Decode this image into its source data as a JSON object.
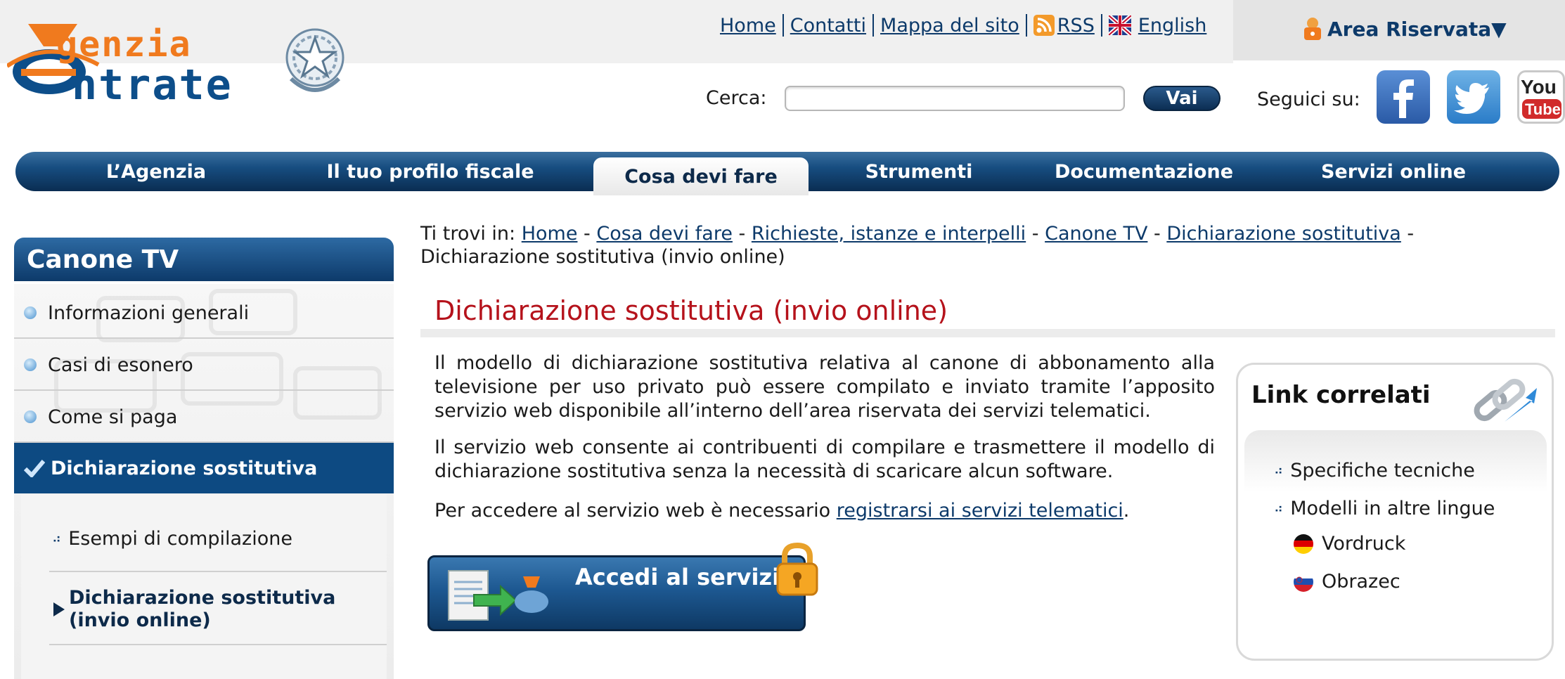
{
  "header": {
    "logo_line1": "genzia",
    "logo_line2": "ntrate",
    "top_links": [
      {
        "label": "Home"
      },
      {
        "label": "Contatti"
      },
      {
        "label": "Mappa del sito"
      },
      {
        "label": "RSS",
        "icon": "rss-icon"
      },
      {
        "label": "English",
        "icon": "uk-flag-icon"
      }
    ],
    "area_riservata": "Area Riservata▼",
    "search_label": "Cerca:",
    "search_value": "",
    "search_button": "Vai",
    "social_label": "Seguici su:",
    "social": [
      "facebook-icon",
      "twitter-icon",
      "youtube-icon"
    ],
    "youtube_text1": "You",
    "youtube_text2": "Tube"
  },
  "nav": {
    "items": [
      "L’Agenzia",
      "Il tuo profilo fiscale",
      "Cosa devi fare",
      "Strumenti",
      "Documentazione",
      "Servizi online"
    ],
    "active_index": 2
  },
  "sidebar": {
    "title": "Canone TV",
    "items": [
      "Informazioni generali",
      "Casi di esonero",
      "Come si paga",
      "Dichiarazione sostitutiva"
    ],
    "active_index": 3,
    "subitems": [
      "Esempi di compilazione",
      "Dichiarazione sostitutiva (invio online)"
    ]
  },
  "breadcrumb": {
    "prefix": "Ti trovi in:",
    "links": [
      "Home",
      "Cosa devi fare",
      "Richieste, istanze e interpelli",
      "Canone TV",
      "Dichiarazione sostitutiva"
    ],
    "current": "Dichiarazione sostitutiva (invio online)",
    "separator": " - "
  },
  "main": {
    "title": "Dichiarazione sostitutiva (invio online)",
    "para1": "Il modello di dichiarazione sostitutiva relativa al canone di abbonamento alla televisione per uso privato può essere compilato e inviato tramite l’apposito servizio web disponibile all’interno dell’area riservata dei servizi telematici.",
    "para2": "Il servizio web consente ai contribuenti di compilare e trasmettere il modello di dichiarazione sostitutiva senza la necessità di scaricare alcun software.",
    "para3_text": "Per accedere al servizio web è necessario ",
    "para3_link": "registrarsi ai servizi telematici",
    "para3_end": ".",
    "access_button": "Accedi al servizio"
  },
  "related": {
    "title": "Link correlati",
    "items": [
      "Specifiche tecniche",
      "Modelli in altre lingue"
    ],
    "languages": [
      {
        "label": "Vordruck",
        "icon": "german-flag-icon"
      },
      {
        "label": "Obrazec",
        "icon": "slovenian-flag-icon"
      }
    ]
  },
  "colors": {
    "brand_blue": "#0d3a6a",
    "brand_orange": "#f07a1e",
    "title_red": "#b5121b",
    "nav_dark": "#0a2d52"
  }
}
